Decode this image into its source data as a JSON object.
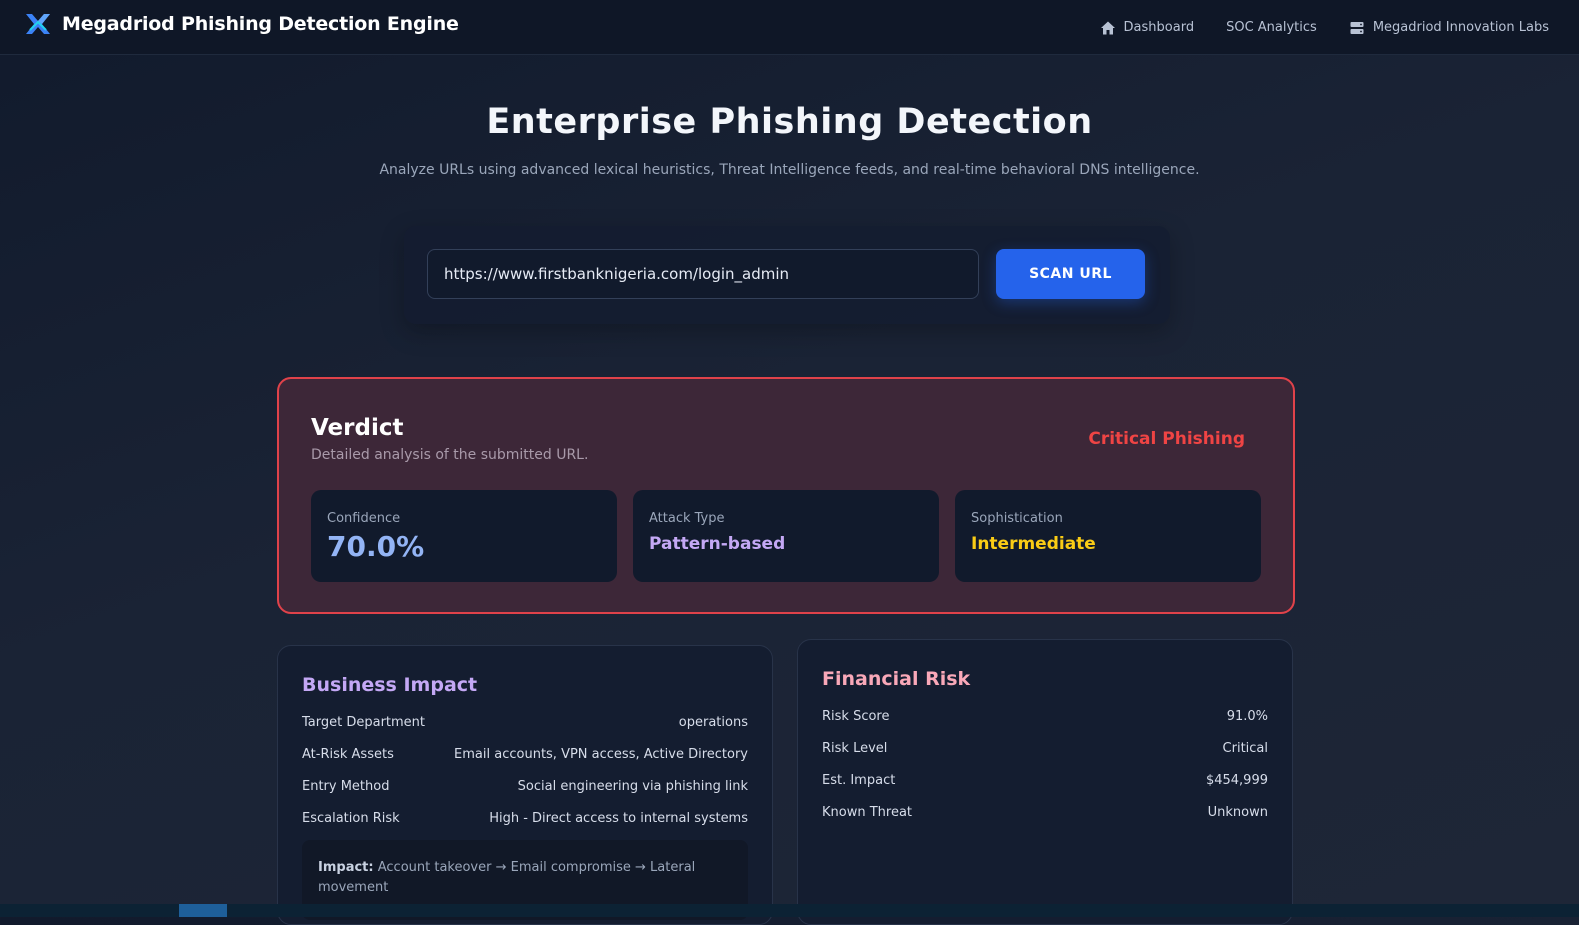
{
  "nav": {
    "brand_title": "Megadriod Phishing Detection Engine",
    "links": [
      {
        "label": "Dashboard",
        "icon": "home-icon"
      },
      {
        "label": "SOC Analytics",
        "icon": ""
      },
      {
        "label": "Megadriod Innovation Labs",
        "icon": "server-icon"
      }
    ]
  },
  "hero": {
    "title": "Enterprise Phishing Detection",
    "subtitle": "Analyze URLs using advanced lexical heuristics, Threat Intelligence feeds, and real-time behavioral DNS intelligence."
  },
  "scan": {
    "url_value": "https://www.firstbanknigeria.com/login_admin",
    "button_label": "SCAN URL"
  },
  "verdict": {
    "title": "Verdict",
    "subtitle": "Detailed analysis of the submitted URL.",
    "status": "Critical Phishing",
    "metrics": [
      {
        "label": "Confidence",
        "value": "70.0%",
        "color": "#93b4f5"
      },
      {
        "label": "Attack Type",
        "value": "Pattern-based",
        "color": "#c4a8f5"
      },
      {
        "label": "Sophistication",
        "value": "Intermediate",
        "color": "#facc15"
      }
    ]
  },
  "business_impact": {
    "title": "Business Impact",
    "rows": [
      {
        "key": "Target Department",
        "value": "operations"
      },
      {
        "key": "At-Risk Assets",
        "value": "Email accounts, VPN access, Active Directory"
      },
      {
        "key": "Entry Method",
        "value": "Social engineering via phishing link"
      },
      {
        "key": "Escalation Risk",
        "value": "High - Direct access to internal systems"
      }
    ],
    "impact_label": "Impact:",
    "impact_text": "Account takeover → Email compromise → Lateral movement"
  },
  "financial_risk": {
    "title": "Financial Risk",
    "rows": [
      {
        "key": "Risk Score",
        "value": "91.0%"
      },
      {
        "key": "Risk Level",
        "value": "Critical"
      },
      {
        "key": "Est. Impact",
        "value": "$454,999"
      },
      {
        "key": "Known Threat",
        "value": "Unknown"
      }
    ]
  },
  "colors": {
    "accent": "#2563eb",
    "danger": "#ef4444",
    "business_title": "#c4a8f5",
    "financial_title": "#f9a8b8"
  }
}
